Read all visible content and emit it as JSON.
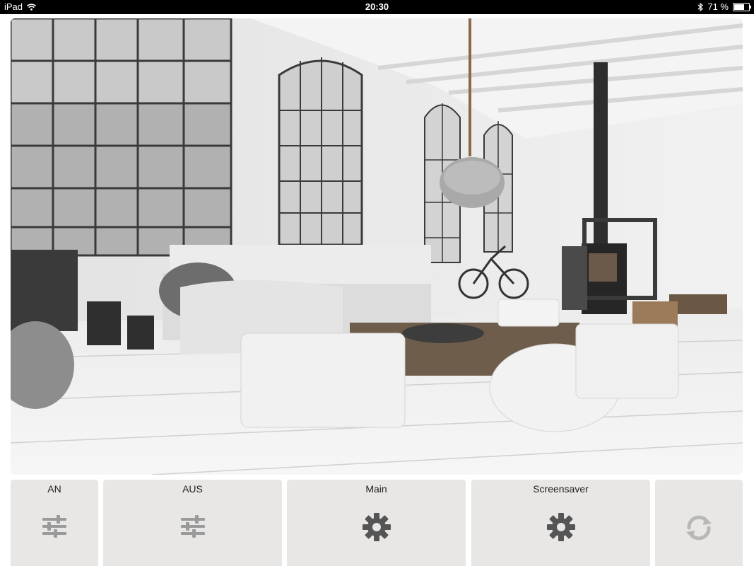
{
  "status_bar": {
    "device": "iPad",
    "time": "20:30",
    "battery_percent_label": "71 %",
    "battery_level": 0.71
  },
  "background_image": {
    "subject": "interior-photo"
  },
  "tiles": [
    {
      "label": "AN",
      "icon": "sliders-icon",
      "icon_color": "#9a9a9a"
    },
    {
      "label": "AUS",
      "icon": "sliders-icon",
      "icon_color": "#9a9a9a"
    },
    {
      "label": "Main",
      "icon": "gear-icon",
      "icon_color": "#555555"
    },
    {
      "label": "Screensaver",
      "icon": "gear-icon",
      "icon_color": "#555555"
    },
    {
      "label": "",
      "icon": "refresh-icon",
      "icon_color": "#b8b8b8"
    }
  ]
}
